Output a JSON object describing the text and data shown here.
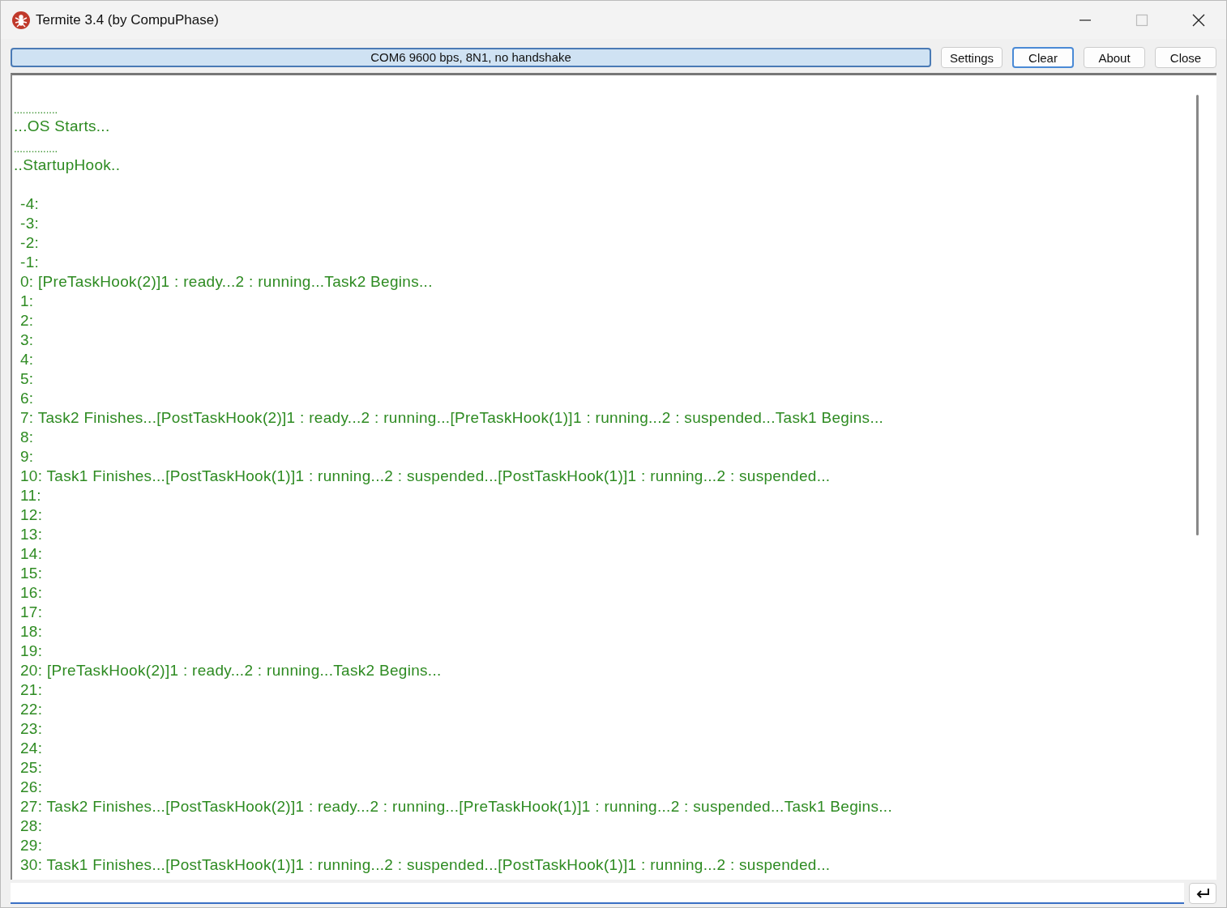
{
  "window": {
    "title": "Termite 3.4 (by CompuPhase)"
  },
  "status": {
    "text": "COM6 9600 bps, 8N1, no handshake"
  },
  "buttons": [
    {
      "label": "Settings",
      "focused": false
    },
    {
      "label": "Clear",
      "focused": true
    },
    {
      "label": "About",
      "focused": false
    },
    {
      "label": "Close",
      "focused": false
    }
  ],
  "terminal": {
    "lines": [
      {
        "kind": "blank"
      },
      {
        "kind": "dots",
        "text": "..............."
      },
      {
        "kind": "text",
        "text": "...OS Starts..."
      },
      {
        "kind": "dots",
        "text": "..............."
      },
      {
        "kind": "text",
        "text": "..StartupHook.."
      },
      {
        "kind": "blank"
      },
      {
        "kind": "counter",
        "text": "-4:"
      },
      {
        "kind": "counter",
        "text": "-3:"
      },
      {
        "kind": "counter",
        "text": "-2:"
      },
      {
        "kind": "counter",
        "text": "-1:"
      },
      {
        "kind": "counter",
        "text": "0: [PreTaskHook(2)]1 : ready...2 : running...Task2 Begins..."
      },
      {
        "kind": "counter",
        "text": "1:"
      },
      {
        "kind": "counter",
        "text": "2:"
      },
      {
        "kind": "counter",
        "text": "3:"
      },
      {
        "kind": "counter",
        "text": "4:"
      },
      {
        "kind": "counter",
        "text": "5:"
      },
      {
        "kind": "counter",
        "text": "6:"
      },
      {
        "kind": "counter",
        "text": "7: Task2 Finishes...[PostTaskHook(2)]1 : ready...2 : running...[PreTaskHook(1)]1 : running...2 : suspended...Task1 Begins..."
      },
      {
        "kind": "counter",
        "text": "8:"
      },
      {
        "kind": "counter",
        "text": "9:"
      },
      {
        "kind": "counter",
        "text": "10: Task1 Finishes...[PostTaskHook(1)]1 : running...2 : suspended...[PostTaskHook(1)]1 : running...2 : suspended..."
      },
      {
        "kind": "counter",
        "text": "11:"
      },
      {
        "kind": "counter",
        "text": "12:"
      },
      {
        "kind": "counter",
        "text": "13:"
      },
      {
        "kind": "counter",
        "text": "14:"
      },
      {
        "kind": "counter",
        "text": "15:"
      },
      {
        "kind": "counter",
        "text": "16:"
      },
      {
        "kind": "counter",
        "text": "17:"
      },
      {
        "kind": "counter",
        "text": "18:"
      },
      {
        "kind": "counter",
        "text": "19:"
      },
      {
        "kind": "counter",
        "text": "20: [PreTaskHook(2)]1 : ready...2 : running...Task2 Begins..."
      },
      {
        "kind": "counter",
        "text": "21:"
      },
      {
        "kind": "counter",
        "text": "22:"
      },
      {
        "kind": "counter",
        "text": "23:"
      },
      {
        "kind": "counter",
        "text": "24:"
      },
      {
        "kind": "counter",
        "text": "25:"
      },
      {
        "kind": "counter",
        "text": "26:"
      },
      {
        "kind": "counter",
        "text": "27: Task2 Finishes...[PostTaskHook(2)]1 : ready...2 : running...[PreTaskHook(1)]1 : running...2 : suspended...Task1 Begins..."
      },
      {
        "kind": "counter",
        "text": "28:"
      },
      {
        "kind": "counter",
        "text": "29:"
      },
      {
        "kind": "counter",
        "text": "30: Task1 Finishes...[PostTaskHook(1)]1 : running...2 : suspended...[PostTaskHook(1)]1 : running...2 : suspended..."
      }
    ]
  }
}
